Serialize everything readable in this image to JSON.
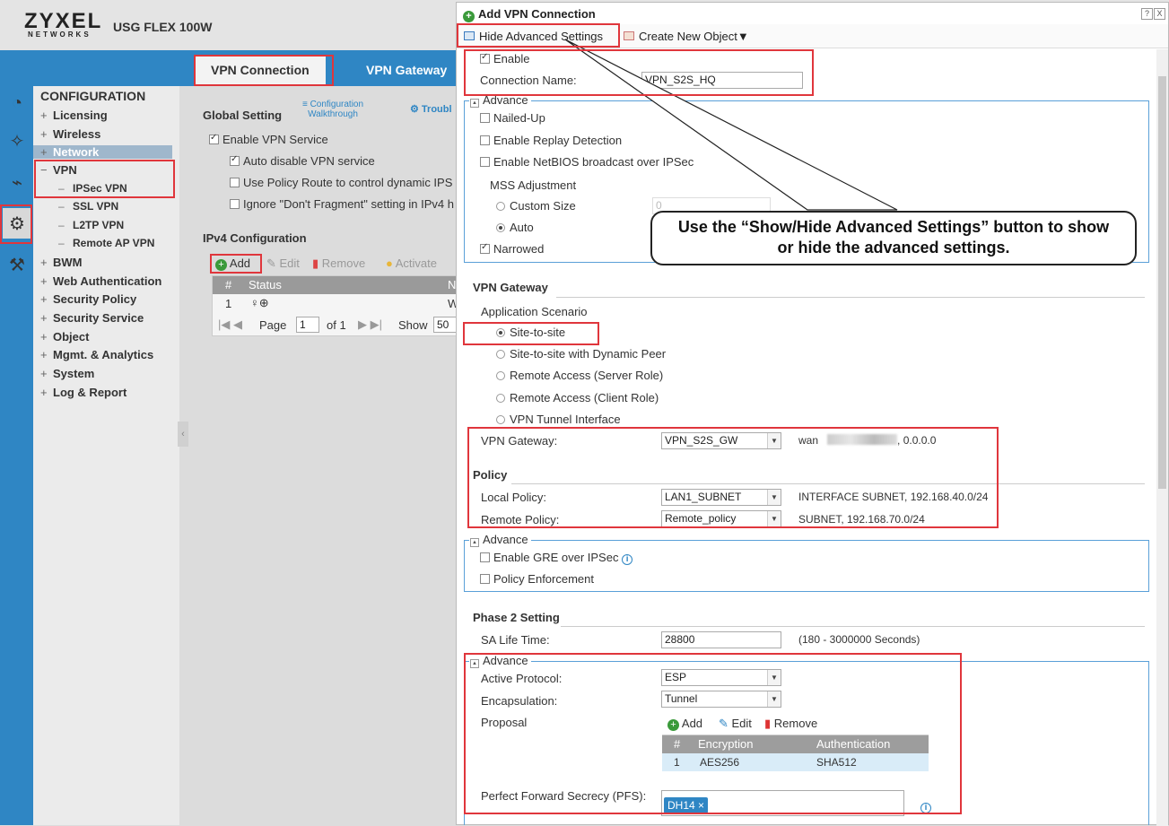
{
  "header": {
    "brand": "ZYXEL",
    "brand_sub": "NETWORKS",
    "model": "USG FLEX 100W"
  },
  "tabs": [
    {
      "label": "VPN Connection"
    },
    {
      "label": "VPN Gateway"
    }
  ],
  "nav": {
    "title": "CONFIGURATION",
    "items": [
      {
        "label": "Licensing",
        "prefix": "+"
      },
      {
        "label": "Wireless",
        "prefix": "+"
      },
      {
        "label": "Network",
        "prefix": "+"
      },
      {
        "label": "VPN",
        "prefix": "−"
      },
      {
        "label": "BWM",
        "prefix": "+"
      },
      {
        "label": "Web Authentication",
        "prefix": "+"
      },
      {
        "label": "Security Policy",
        "prefix": "+"
      },
      {
        "label": "Security Service",
        "prefix": "+"
      },
      {
        "label": "Object",
        "prefix": "+"
      },
      {
        "label": "Mgmt. & Analytics",
        "prefix": "+"
      },
      {
        "label": "System",
        "prefix": "+"
      },
      {
        "label": "Log & Report",
        "prefix": "+"
      }
    ],
    "vpn_sub": [
      "IPSec VPN",
      "SSL VPN",
      "L2TP VPN",
      "Remote AP VPN"
    ]
  },
  "background": {
    "global_setting": "Global Setting",
    "config_walkthrough": "Configuration Walkthrough",
    "troubleshoot": "Troubl",
    "enable_vpn_service": "Enable VPN Service",
    "auto_disable": "Auto disable VPN service",
    "use_policy_route": "Use Policy Route to control dynamic IPS",
    "ignore_df": "Ignore \"Don't Fragment\" setting in IPv4 h",
    "ipv4_config": "IPv4 Configuration",
    "toolbar": {
      "add": "Add",
      "edit": "Edit",
      "remove": "Remove",
      "activate": "Activate"
    },
    "table_head": {
      "num": "#",
      "status": "Status",
      "name": "N"
    },
    "table_row": {
      "num": "1",
      "name": "W"
    },
    "pager": {
      "page_label": "Page",
      "page_value": "1",
      "of": "of 1",
      "show": "Show",
      "show_value": "50"
    }
  },
  "dialog": {
    "title": "Add VPN Connection",
    "help": "?",
    "close": "X",
    "toolbar": {
      "hide_advanced": "Hide Advanced Settings",
      "create_new_object": "Create New Object▼"
    },
    "enable_label": "Enable",
    "connection_name_label": "Connection Name:",
    "connection_name_value": "VPN_S2S_HQ",
    "advance_label": "Advance",
    "advance1": {
      "nailed_up": "Nailed-Up",
      "replay_detection": "Enable Replay Detection",
      "netbios": "Enable NetBIOS broadcast over IPSec",
      "mss_adjustment": "MSS Adjustment",
      "custom_size": "Custom Size",
      "custom_size_value": "0",
      "auto": "Auto",
      "narrowed": "Narrowed"
    },
    "vpn_gateway_section": "VPN Gateway",
    "application_scenario": "Application Scenario",
    "scenarios": [
      "Site-to-site",
      "Site-to-site with Dynamic Peer",
      "Remote Access (Server Role)",
      "Remote Access (Client Role)",
      "VPN Tunnel Interface"
    ],
    "vpn_gateway_label": "VPN Gateway:",
    "vpn_gateway_value": "VPN_S2S_GW",
    "vpn_gateway_info_prefix": "wan",
    "vpn_gateway_info_suffix": ", 0.0.0.0",
    "policy_section": "Policy",
    "local_policy_label": "Local Policy:",
    "local_policy_value": "LAN1_SUBNET",
    "local_policy_info": "INTERFACE SUBNET, 192.168.40.0/24",
    "remote_policy_label": "Remote Policy:",
    "remote_policy_value": "Remote_policy",
    "remote_policy_info": "SUBNET, 192.168.70.0/24",
    "advance2": {
      "gre": "Enable GRE over IPSec",
      "policy_enforcement": "Policy Enforcement"
    },
    "phase2_section": "Phase 2 Setting",
    "sa_lifetime_label": "SA Life Time:",
    "sa_lifetime_value": "28800",
    "sa_lifetime_hint": "(180 - 3000000 Seconds)",
    "active_protocol_label": "Active Protocol:",
    "active_protocol_value": "ESP",
    "encapsulation_label": "Encapsulation:",
    "encapsulation_value": "Tunnel",
    "proposal_label": "Proposal",
    "proposal_toolbar": {
      "add": "Add",
      "edit": "Edit",
      "remove": "Remove"
    },
    "proposal_head": {
      "num": "#",
      "encryption": "Encryption",
      "authentication": "Authentication"
    },
    "proposal_row": {
      "num": "1",
      "encryption": "AES256",
      "authentication": "SHA512"
    },
    "pfs_label": "Perfect Forward Secrecy (PFS):",
    "pfs_value": "DH14"
  },
  "callout": {
    "line1": "Use the “Show/Hide Advanced Settings” button to show",
    "line2": "or hide the advanced settings."
  },
  "colors": {
    "accent": "#2f86c4",
    "highlight": "#e0363c",
    "nav_bg": "#ebebeb"
  }
}
